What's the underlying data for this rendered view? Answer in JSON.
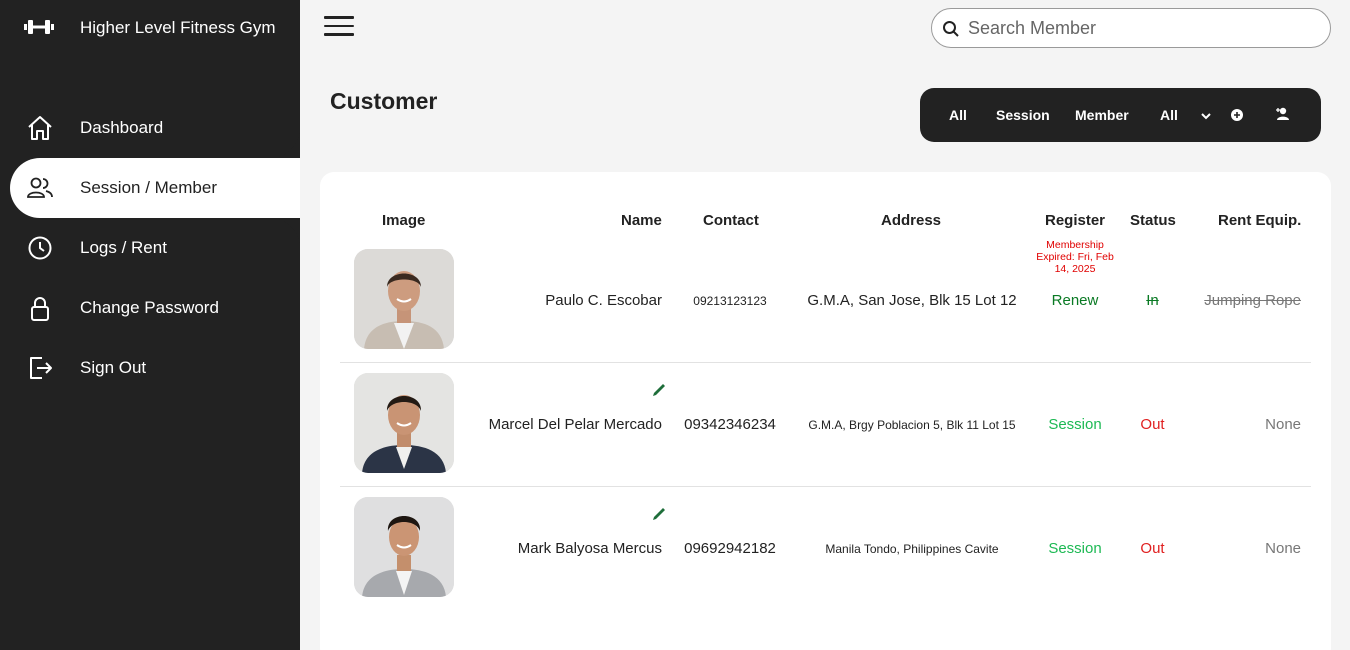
{
  "app": {
    "title": "Higher Level Fitness Gym",
    "brand_icon": "dumbbell-icon"
  },
  "sidebar": {
    "items": [
      {
        "label": "Dashboard",
        "icon": "home-icon",
        "active": false
      },
      {
        "label": "Session / Member",
        "icon": "users-icon",
        "active": true
      },
      {
        "label": "Logs / Rent",
        "icon": "clock-icon",
        "active": false
      },
      {
        "label": "Change Password",
        "icon": "lock-icon",
        "active": false
      },
      {
        "label": "Sign Out",
        "icon": "sign-out-icon",
        "active": false
      }
    ]
  },
  "header": {
    "menu_icon": "hamburger-menu-icon",
    "search": {
      "placeholder": "Search Member",
      "value": ""
    }
  },
  "page": {
    "title": "Customer",
    "filters": {
      "all": "All",
      "session": "Session",
      "member": "Member",
      "select_value": "All",
      "add_icon": "plus-circle-icon",
      "add_user_icon": "add-user-icon"
    }
  },
  "table": {
    "columns": [
      "Image",
      "Name",
      "Contact",
      "Address",
      "Register",
      "Status",
      "Rent Equip."
    ],
    "rows": [
      {
        "name": "Paulo C. Escobar",
        "contact": "09213123123",
        "address": "G.M.A, San Jose, Blk 15 Lot 12",
        "notice": "Membership Expired: Fri, Feb 14, 2025",
        "register": "Renew",
        "status": "In",
        "rent": "Jumping Rope",
        "editable": false
      },
      {
        "name": "Marcel Del Pelar Mercado",
        "contact": "09342346234",
        "address": "G.M.A, Brgy Poblacion 5, Blk 11 Lot 15",
        "register": "Session",
        "status": "Out",
        "rent": "None",
        "editable": true
      },
      {
        "name": "Mark Balyosa Mercus",
        "contact": "09692942182",
        "address": "Manila Tondo, Philippines Cavite",
        "register": "Session",
        "status": "Out",
        "rent": "None",
        "editable": true
      }
    ]
  },
  "colors": {
    "sidebar_bg": "#222222",
    "renew_green": "#0a7a24",
    "session_green": "#1db954",
    "out_red": "#e02020",
    "expired_red": "#e00000",
    "muted_gray": "#777777"
  }
}
